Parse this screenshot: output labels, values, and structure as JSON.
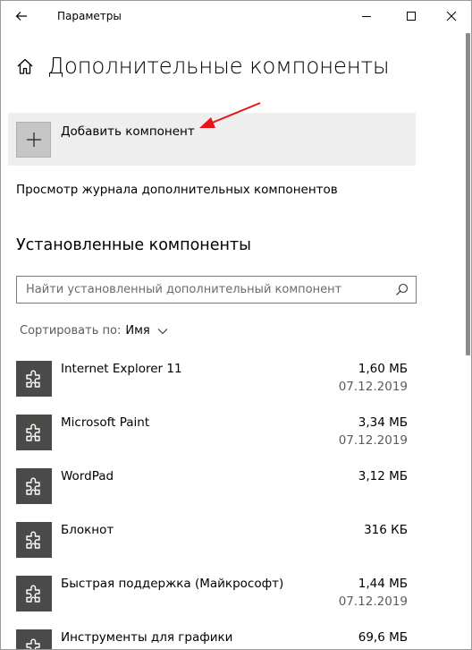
{
  "window": {
    "title": "Параметры"
  },
  "header": {
    "page_title": "Дополнительные компоненты"
  },
  "add_component": {
    "label": "Добавить компонент"
  },
  "history_link": "Просмотр журнала дополнительных компонентов",
  "installed": {
    "section_title": "Установленные компоненты",
    "search_placeholder": "Найти установленный дополнительный компонент",
    "sort_label": "Сортировать по:",
    "sort_value": "Имя",
    "items": [
      {
        "name": "Internet Explorer 11",
        "size": "1,60 МБ",
        "date": "07.12.2019"
      },
      {
        "name": "Microsoft Paint",
        "size": "3,34 МБ",
        "date": "07.12.2019"
      },
      {
        "name": "WordPad",
        "size": "3,12 МБ",
        "date": ""
      },
      {
        "name": "Блокнот",
        "size": "316 КБ",
        "date": ""
      },
      {
        "name": "Быстрая поддержка (Майкрософт)",
        "size": "1,44 МБ",
        "date": "07.12.2019"
      },
      {
        "name": "Инструменты для графики",
        "size": "69,6 МБ",
        "date": ""
      }
    ]
  },
  "icons": {
    "back": "arrow-left-icon",
    "home": "home-icon",
    "add": "plus-icon",
    "search": "search-icon",
    "component": "puzzle-icon",
    "annotation": "red-arrow-icon"
  },
  "colors": {
    "tile": "#4c4a48",
    "add_background": "#eeeeee",
    "annotation_arrow": "#e8141b"
  }
}
